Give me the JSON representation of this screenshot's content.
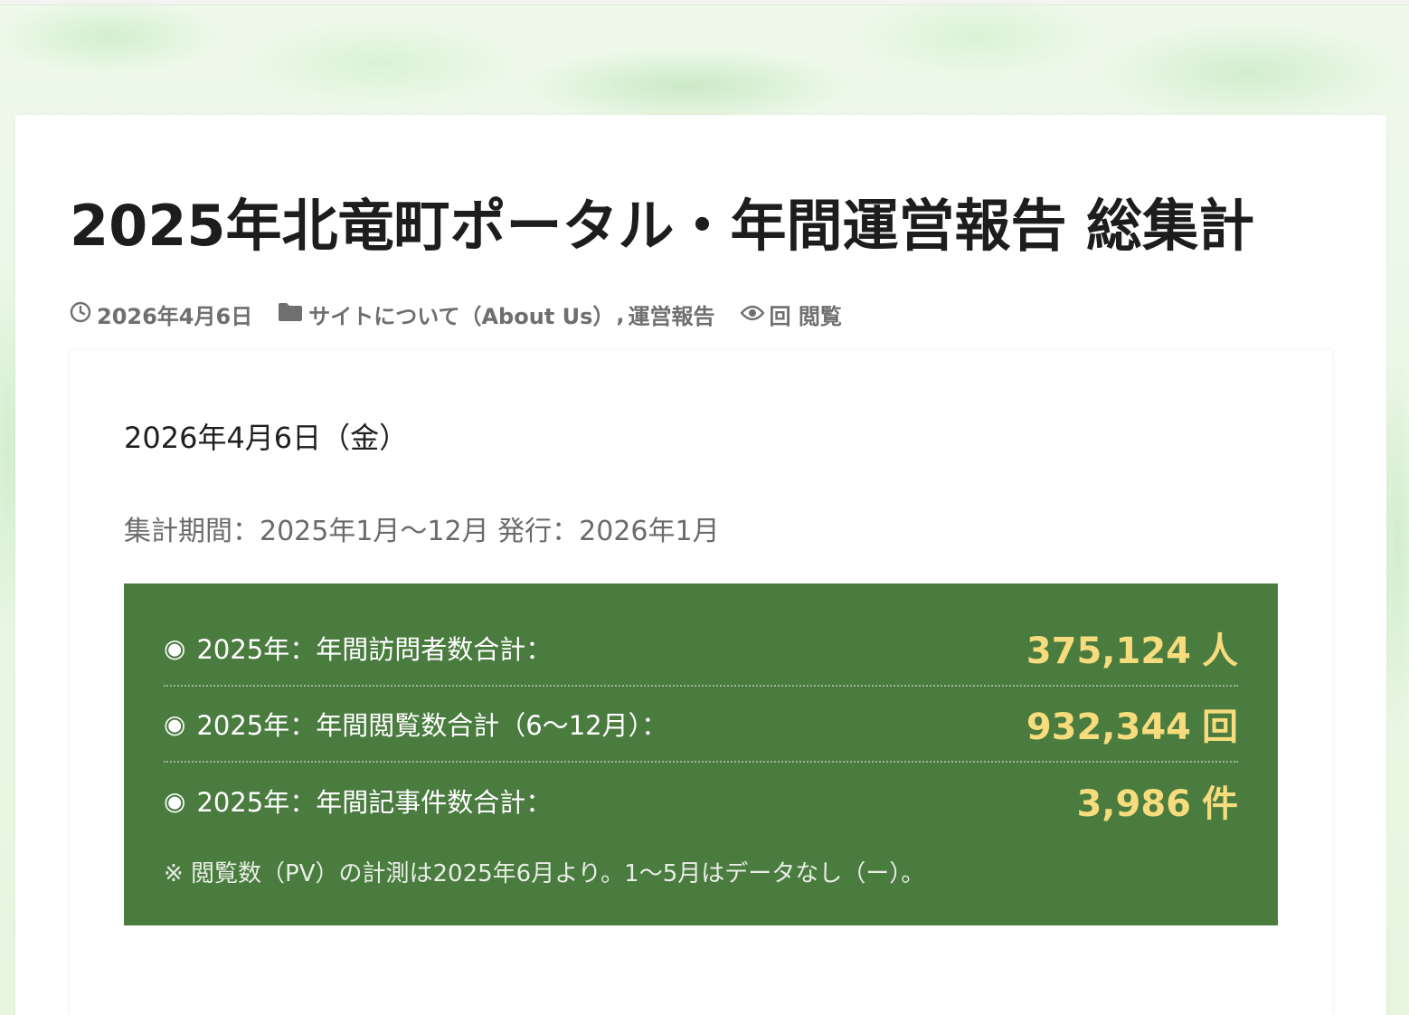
{
  "post": {
    "title": "2025年北竜町ポータル・年間運営報告 総集計",
    "meta": {
      "date": "2026年4月6日",
      "category_1": "サイトについて（About Us）",
      "category_sep": ",",
      "category_2": "運営報告",
      "views": "回 閲覧"
    }
  },
  "content": {
    "date_line": "2026年4月6日（金）",
    "period_line": "集計期間：2025年1月〜12月 発行：2026年1月",
    "stats": [
      {
        "bullet": "◉",
        "label": "2025年：年間訪問者数合計：",
        "value": "375,124",
        "unit": "人"
      },
      {
        "bullet": "◉",
        "label": "2025年：年間閲覧数合計（6〜12月）：",
        "value": "932,344",
        "unit": "回"
      },
      {
        "bullet": "◉",
        "label": "2025年：年間記事件数合計：",
        "value": "3,986",
        "unit": "件"
      }
    ],
    "note": "※ 閲覧数（PV）の計測は2025年6月より。1〜5月はデータなし（ー）。"
  },
  "colors": {
    "stat_box_bg": "#4a7b3f",
    "stat_value": "#f6dc7c",
    "title_text": "#1d1d1d",
    "meta_text": "#6f6f6f"
  },
  "icons": {
    "date": "clock-icon",
    "category": "folder-icon",
    "views": "eye-icon"
  }
}
